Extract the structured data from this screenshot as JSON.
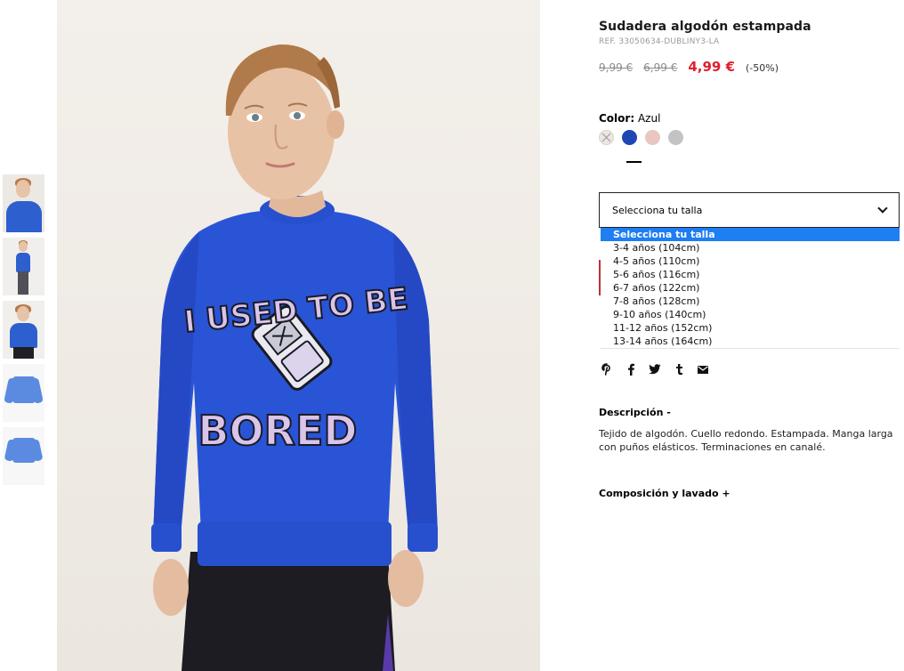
{
  "product": {
    "title": "Sudadera algodón estampada",
    "ref": "REF. 33050634-DUBLINY3-LA",
    "old_price_1": "9,99 €",
    "old_price_2": "6,99 €",
    "sale_price": "4,99 €",
    "discount": "(-50%)"
  },
  "color": {
    "label": "Color:",
    "value": "Azul",
    "swatches": [
      {
        "name": "cream",
        "color": "#ece7e1",
        "available": false
      },
      {
        "name": "blue",
        "color": "#1e46b5",
        "selected": true
      },
      {
        "name": "pink",
        "color": "#e9c6c0"
      },
      {
        "name": "grey",
        "color": "#c3c3c3"
      }
    ]
  },
  "size": {
    "placeholder": "Selecciona tu talla",
    "options": [
      "Selecciona tu talla",
      "3-4 años (104cm)",
      "4-5 años (110cm)",
      "5-6 años (116cm)",
      "6-7 años (122cm)",
      "7-8 años (128cm)",
      "9-10 años (140cm)",
      "11-12 años (152cm)",
      "13-14 años (164cm)"
    ]
  },
  "share_icons": [
    "pinterest-icon",
    "facebook-icon",
    "twitter-icon",
    "tumblr-icon",
    "email-icon"
  ],
  "description": {
    "heading": "Descripción  -",
    "text": "Tejido de algodón. Cuello redondo. Estampada. Manga larga con puños elásticos. Terminaciones en canalé."
  },
  "composition": {
    "heading": "Composición y lavado  +"
  },
  "photo": {
    "print_line1": "I USED TO BE",
    "print_line2": "BORED",
    "sweater_color": "#2a54d6"
  }
}
